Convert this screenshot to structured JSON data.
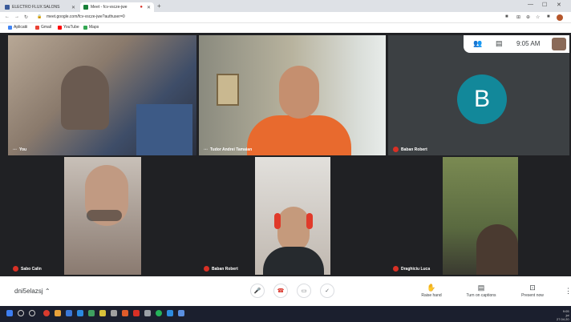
{
  "browser": {
    "tabs": [
      {
        "label": "ELECTRO FLUX SALONS",
        "color": "#3b5b9a"
      },
      {
        "label": "Meet - fcv-vscze-jwe",
        "color": "#188038"
      }
    ],
    "new_tab": "+",
    "window_controls": [
      "—",
      "☐",
      "✕"
    ],
    "url": "meet.google.com/fcv-vscze-jwe?authuser=0",
    "bookmarks": [
      {
        "label": "Aplicatii",
        "color": "#4285f4"
      },
      {
        "label": "Gmail",
        "color": "#ea4335"
      },
      {
        "label": "YouTube",
        "color": "#ff0000"
      },
      {
        "label": "Maps",
        "color": "#34a853"
      }
    ]
  },
  "meet": {
    "time": "9:05 AM",
    "participants": [
      {
        "name": "You",
        "muted": false
      },
      {
        "name": "Tudor Andrei Tamaian",
        "muted": false
      },
      {
        "name": "Baban Robert",
        "muted": true,
        "initial": "B"
      },
      {
        "name": "Sabo Calin",
        "muted": true
      },
      {
        "name": "Baban Robert",
        "muted": true
      },
      {
        "name": "Draghiciu Luca",
        "muted": true
      }
    ],
    "meeting_code": "dni5elazsj",
    "actions": [
      {
        "label": "Raise hand",
        "icon": "✋"
      },
      {
        "label": "Turn on captions",
        "icon": "▤"
      },
      {
        "label": "Present now",
        "icon": "⊡"
      }
    ]
  },
  "taskbar": {
    "clock_time": "9:05",
    "clock_day": "joi",
    "clock_date": "27.04.20"
  },
  "colors": {
    "meet_bg": "#202124",
    "accent_avatar": "#12889a",
    "mute_red": "#d93025"
  }
}
